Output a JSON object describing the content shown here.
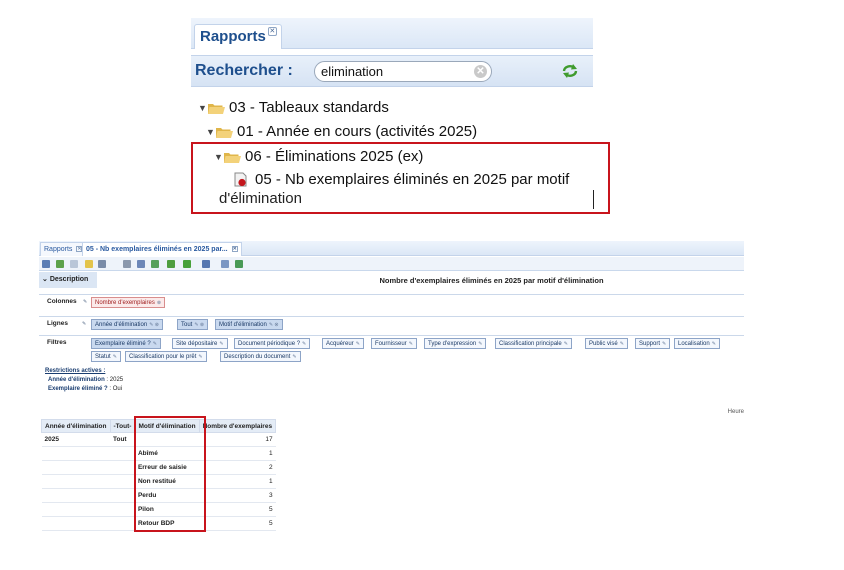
{
  "top_panel": {
    "tab_label": "Rapports",
    "search_label": "Rechercher :",
    "search_value": "elimination",
    "tree": [
      {
        "label": "03 - Tableaux standards"
      },
      {
        "label": "01 - Année en cours (activités 2025)"
      },
      {
        "label": "06 - Éliminations 2025 (ex)"
      }
    ],
    "report_line1": "05 - Nb exemplaires éliminés en 2025 par motif",
    "report_line2": "d'élimination"
  },
  "app": {
    "tabs": [
      {
        "label": "Rapports"
      },
      {
        "label": "05 - Nb exemplaires éliminés en 2025 par..."
      }
    ],
    "description_label": "Description",
    "report_title": "Nombre d'exemplaires éliminés en 2025 par motif d'élimination",
    "colonnes": {
      "label": "Colonnes",
      "items": [
        "Nombre d'exemplaires"
      ]
    },
    "lignes": {
      "label": "Lignes",
      "items": [
        "Année d'élimination",
        "Tout",
        "Motif d'élimination"
      ]
    },
    "filtres": {
      "label": "Filtres",
      "row1": [
        "Exemplaire éliminé ?",
        "Site dépositaire",
        "Document périodique ?",
        "Acquéreur",
        "Fournisseur",
        "Type d'expression",
        "Classification principale",
        "Public visé",
        "Support",
        "Localisation"
      ],
      "row2": [
        "Statut",
        "Classification pour le prêt",
        "Description du document"
      ]
    },
    "restrictions": {
      "title": "Restrictions actives :",
      "items": [
        {
          "key": "Année d'élimination",
          "value": " : 2025"
        },
        {
          "key": "Exemplaire éliminé ?",
          "value": " : Oui"
        }
      ]
    },
    "heure_label": "Heure",
    "table": {
      "headers": [
        "Année d'élimination",
        "-Tout-",
        "Motif d'élimination",
        "Nombre d'exemplaires"
      ],
      "year": "2025",
      "tout": "Tout",
      "total": "17",
      "rows": [
        {
          "motif": "Abîmé",
          "count": "1"
        },
        {
          "motif": "Erreur de saisie",
          "count": "2"
        },
        {
          "motif": "Non restitué",
          "count": "1"
        },
        {
          "motif": "Perdu",
          "count": "3"
        },
        {
          "motif": "Pilon",
          "count": "5"
        },
        {
          "motif": "Retour BDP",
          "count": "5"
        }
      ]
    }
  }
}
